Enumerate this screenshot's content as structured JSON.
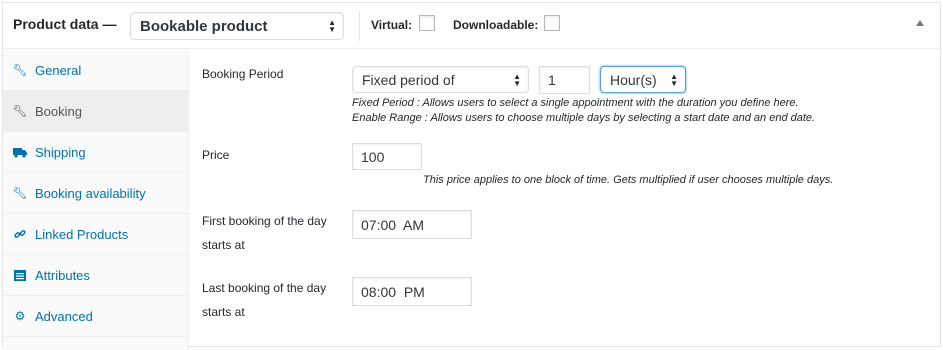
{
  "header": {
    "title": "Product data —",
    "product_type": "Bookable product",
    "virtual_label": "Virtual:",
    "downloadable_label": "Downloadable:"
  },
  "sidebar": {
    "items": [
      {
        "label": "General",
        "icon": "wrench-icon",
        "active": false
      },
      {
        "label": "Booking",
        "icon": "wrench-icon",
        "active": true
      },
      {
        "label": "Shipping",
        "icon": "truck-icon",
        "active": false
      },
      {
        "label": "Booking availability",
        "icon": "wrench-icon",
        "active": false
      },
      {
        "label": "Linked Products",
        "icon": "link-icon",
        "active": false
      },
      {
        "label": "Attributes",
        "icon": "list-icon",
        "active": false
      },
      {
        "label": "Advanced",
        "icon": "gear-icon",
        "active": false
      }
    ]
  },
  "booking": {
    "period_label": "Booking Period",
    "period_type": "Fixed period of",
    "period_value": "1",
    "period_unit": "Hour(s)",
    "period_note_1": "Fixed Period : Allows users to select a single appointment with the duration you define here.",
    "period_note_2": "Enable Range : Allows users to choose multiple days by selecting a start date and an end date.",
    "price_label": "Price",
    "price_value": "100",
    "price_note": "This price applies to one block of time. Gets multiplied if user chooses multiple days.",
    "first_label_1": "First booking of the day",
    "first_label_2": "starts at",
    "first_value": "07:00  AM",
    "last_label_1": "Last booking of the day",
    "last_label_2": "starts at",
    "last_value": "08:00  PM"
  },
  "colors": {
    "link": "#0073aa",
    "focus": "#5b9dd9",
    "active_tab_bg": "#eeeeee"
  }
}
